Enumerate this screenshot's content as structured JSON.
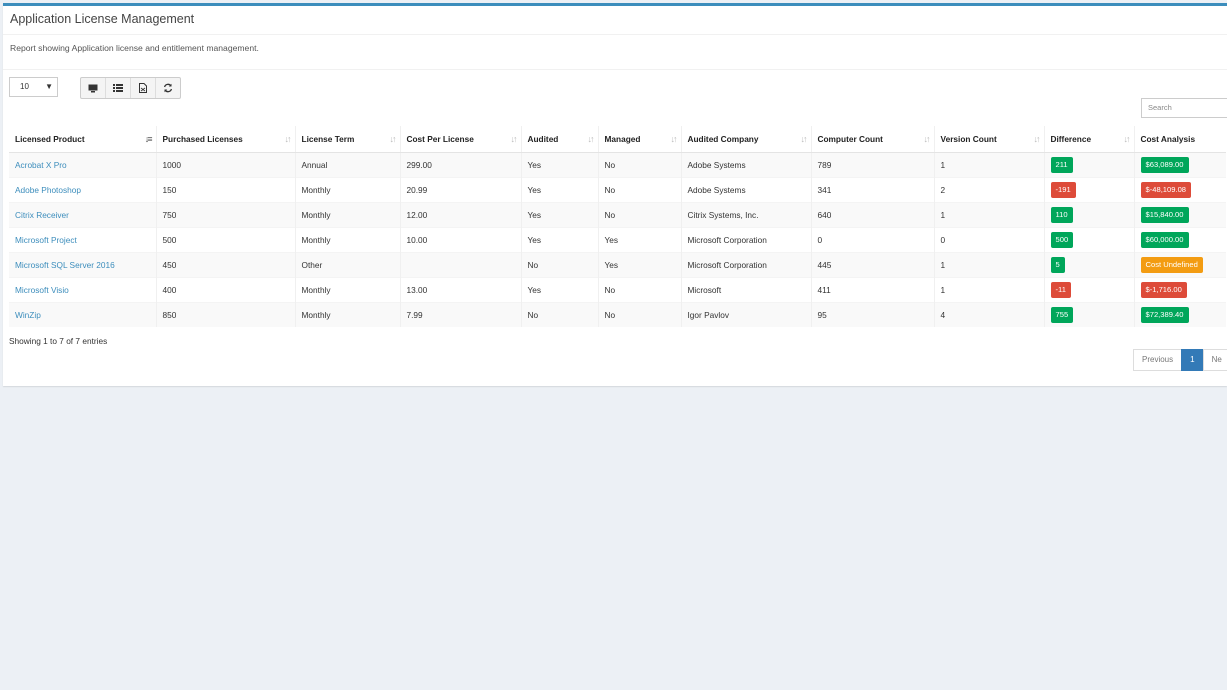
{
  "header": {
    "title": "Application License Management",
    "subtitle": "Report showing Application license and entitlement management."
  },
  "toolbar": {
    "page_size": "10",
    "buttons": [
      "monitor-icon",
      "list-icon",
      "export-file-icon",
      "refresh-icon"
    ],
    "search_placeholder": "Search"
  },
  "table": {
    "columns": [
      "Licensed Product",
      "Purchased Licenses",
      "License Term",
      "Cost Per License",
      "Audited",
      "Managed",
      "Audited Company",
      "Computer Count",
      "Version Count",
      "Difference",
      "Cost Analysis"
    ],
    "rows": [
      {
        "product": "Acrobat X Pro",
        "purchased": "1000",
        "term": "Annual",
        "cost": "299.00",
        "audited": "Yes",
        "managed": "No",
        "company": "Adobe Systems",
        "computers": "789",
        "versions": "1",
        "difference": "211",
        "diff_status": "green",
        "analysis": "$63,089.00",
        "analysis_status": "green"
      },
      {
        "product": "Adobe Photoshop",
        "purchased": "150",
        "term": "Monthly",
        "cost": "20.99",
        "audited": "Yes",
        "managed": "No",
        "company": "Adobe Systems",
        "computers": "341",
        "versions": "2",
        "difference": "-191",
        "diff_status": "red",
        "analysis": "$-48,109.08",
        "analysis_status": "red"
      },
      {
        "product": "Citrix Receiver",
        "purchased": "750",
        "term": "Monthly",
        "cost": "12.00",
        "audited": "Yes",
        "managed": "No",
        "company": "Citrix Systems, Inc.",
        "computers": "640",
        "versions": "1",
        "difference": "110",
        "diff_status": "green",
        "analysis": "$15,840.00",
        "analysis_status": "green"
      },
      {
        "product": "Microsoft Project",
        "purchased": "500",
        "term": "Monthly",
        "cost": "10.00",
        "audited": "Yes",
        "managed": "Yes",
        "company": "Microsoft Corporation",
        "computers": "0",
        "versions": "0",
        "difference": "500",
        "diff_status": "green",
        "analysis": "$60,000.00",
        "analysis_status": "green"
      },
      {
        "product": "Microsoft SQL Server 2016",
        "purchased": "450",
        "term": "Other",
        "cost": "",
        "audited": "No",
        "managed": "Yes",
        "company": "Microsoft Corporation",
        "computers": "445",
        "versions": "1",
        "difference": "5",
        "diff_status": "green",
        "analysis": "Cost Undefined",
        "analysis_status": "orange"
      },
      {
        "product": "Microsoft Visio",
        "purchased": "400",
        "term": "Monthly",
        "cost": "13.00",
        "audited": "Yes",
        "managed": "No",
        "company": "Microsoft",
        "computers": "411",
        "versions": "1",
        "difference": "-11",
        "diff_status": "red",
        "analysis": "$-1,716.00",
        "analysis_status": "red"
      },
      {
        "product": "WinZip",
        "purchased": "850",
        "term": "Monthly",
        "cost": "7.99",
        "audited": "No",
        "managed": "No",
        "company": "Igor Pavlov",
        "computers": "95",
        "versions": "4",
        "difference": "755",
        "diff_status": "green",
        "analysis": "$72,389.40",
        "analysis_status": "green"
      }
    ]
  },
  "footer": {
    "info": "Showing 1 to 7 of 7 entries",
    "pager": [
      "Previous",
      "1",
      "Ne"
    ],
    "active_page": "1"
  },
  "colors": {
    "accent": "#3c8dbc",
    "green": "#00a65a",
    "red": "#dd4b39",
    "orange": "#f39c12"
  }
}
